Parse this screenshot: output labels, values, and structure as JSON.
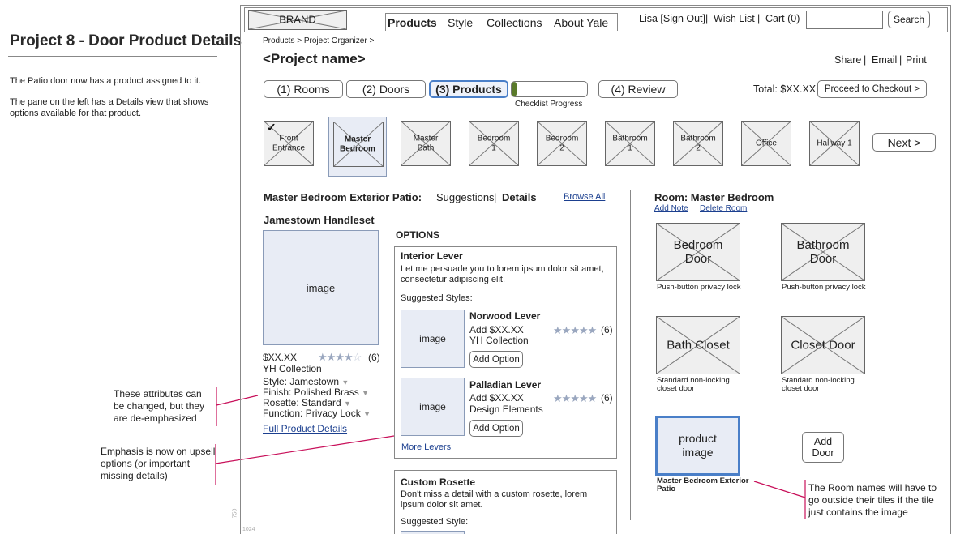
{
  "notes": {
    "title": "Project 8 - Door Product Details",
    "para1": "The Patio door now has a product assigned to it.",
    "para2": "The pane on the left has a Details view that shows options available for that product.",
    "callout1": "These attributes can be changed, but they are de-emphasized",
    "callout2": "Emphasis is now on upsell options (or important missing details)",
    "callout3": "The Room names will have to go outside their tiles if the tile just contains the image",
    "ruler_v": "750",
    "ruler_h": "1024"
  },
  "header": {
    "brand": "BRAND",
    "nav": [
      "Products",
      "Style",
      "Collections",
      "About Yale"
    ],
    "user": "Lisa [Sign Out]",
    "sep": "|",
    "wishlist": "Wish List",
    "cart": "Cart (0)",
    "search_value": "",
    "search_label": "Search"
  },
  "breadcrumb": "Products > Project Organizer >",
  "project_name": "<Project name>",
  "actions": {
    "share": "Share",
    "email": "Email",
    "print": "Print"
  },
  "steps": [
    "(1) Rooms",
    "(2) Doors",
    "(3) Products",
    "(4) Review"
  ],
  "checklist_label": "Checklist Progress",
  "checklist_progress": 0.06,
  "total": "Total: $XX.XX",
  "checkout": "Proceed to Checkout >",
  "rooms": [
    {
      "label": "Front Entrance",
      "checked": true,
      "selected": false
    },
    {
      "label": "Master Bedroom",
      "checked": false,
      "selected": true
    },
    {
      "label": "Master Bath",
      "checked": false,
      "selected": false
    },
    {
      "label": "Bedroom 1",
      "checked": false,
      "selected": false
    },
    {
      "label": "Bedroom 2",
      "checked": false,
      "selected": false
    },
    {
      "label": "Bathroom 1",
      "checked": false,
      "selected": false
    },
    {
      "label": "Bathroom 2",
      "checked": false,
      "selected": false
    },
    {
      "label": "Office",
      "checked": false,
      "selected": false
    },
    {
      "label": "Hallway 1",
      "checked": false,
      "selected": false
    }
  ],
  "next": "Next >",
  "left": {
    "heading": "Master Bedroom Exterior Patio:",
    "tab_suggestions": "Suggestions",
    "tab_sep": "|",
    "tab_details": "Details",
    "browse_all": "Browse All",
    "product_name": "Jamestown Handleset",
    "image": "image",
    "price": "$XX.XX",
    "rating_count": "(6)",
    "rating": 4,
    "collection": "YH Collection",
    "attributes": [
      "Style: Jamestown",
      "Finish: Polished Brass",
      "Rosette: Standard",
      "Function: Privacy Lock"
    ],
    "full_details": "Full Product Details"
  },
  "options": {
    "heading": "OPTIONS",
    "group1": {
      "title": "Interior Lever",
      "desc": "Let me persuade you to lorem ipsum dolor sit amet, consectetur adipiscing elit.",
      "suggested": "Suggested Styles:",
      "items": [
        {
          "image": "image",
          "name": "Norwood Lever",
          "price": "Add $XX.XX",
          "collection": "YH Collection",
          "rating": 5,
          "count": "(6)",
          "button": "Add Option"
        },
        {
          "image": "image",
          "name": "Palladian Lever",
          "price": "Add $XX.XX",
          "collection": "Design Elements",
          "rating": 5,
          "count": "(6)",
          "button": "Add Option"
        }
      ],
      "more": "More Levers"
    },
    "group2": {
      "title": "Custom Rosette",
      "desc": "Don't miss a detail with a custom rosette, lorem ipsum dolor sit amet.",
      "suggested": "Suggested Style:"
    }
  },
  "room": {
    "heading": "Room: Master Bedroom",
    "add_note": "Add Note",
    "delete_room": "Delete Room",
    "doors": [
      {
        "label": "Bedroom Door",
        "caption": "Push-button privacy lock"
      },
      {
        "label": "Bathroom Door",
        "caption": "Push-button privacy lock"
      },
      {
        "label": "Bath Closet",
        "caption": "Standard non-locking closet door"
      },
      {
        "label": "Closet Door",
        "caption": "Standard non-locking closet door"
      }
    ],
    "product_image": "product image",
    "product_caption": "Master Bedroom Exterior Patio",
    "add_door": "Add Door"
  },
  "colors": {
    "annotation": "#c8105a",
    "selected_blue": "#4a7fc8",
    "progress_green": "#5a7a2a",
    "image_fill": "#e8ecf5"
  }
}
